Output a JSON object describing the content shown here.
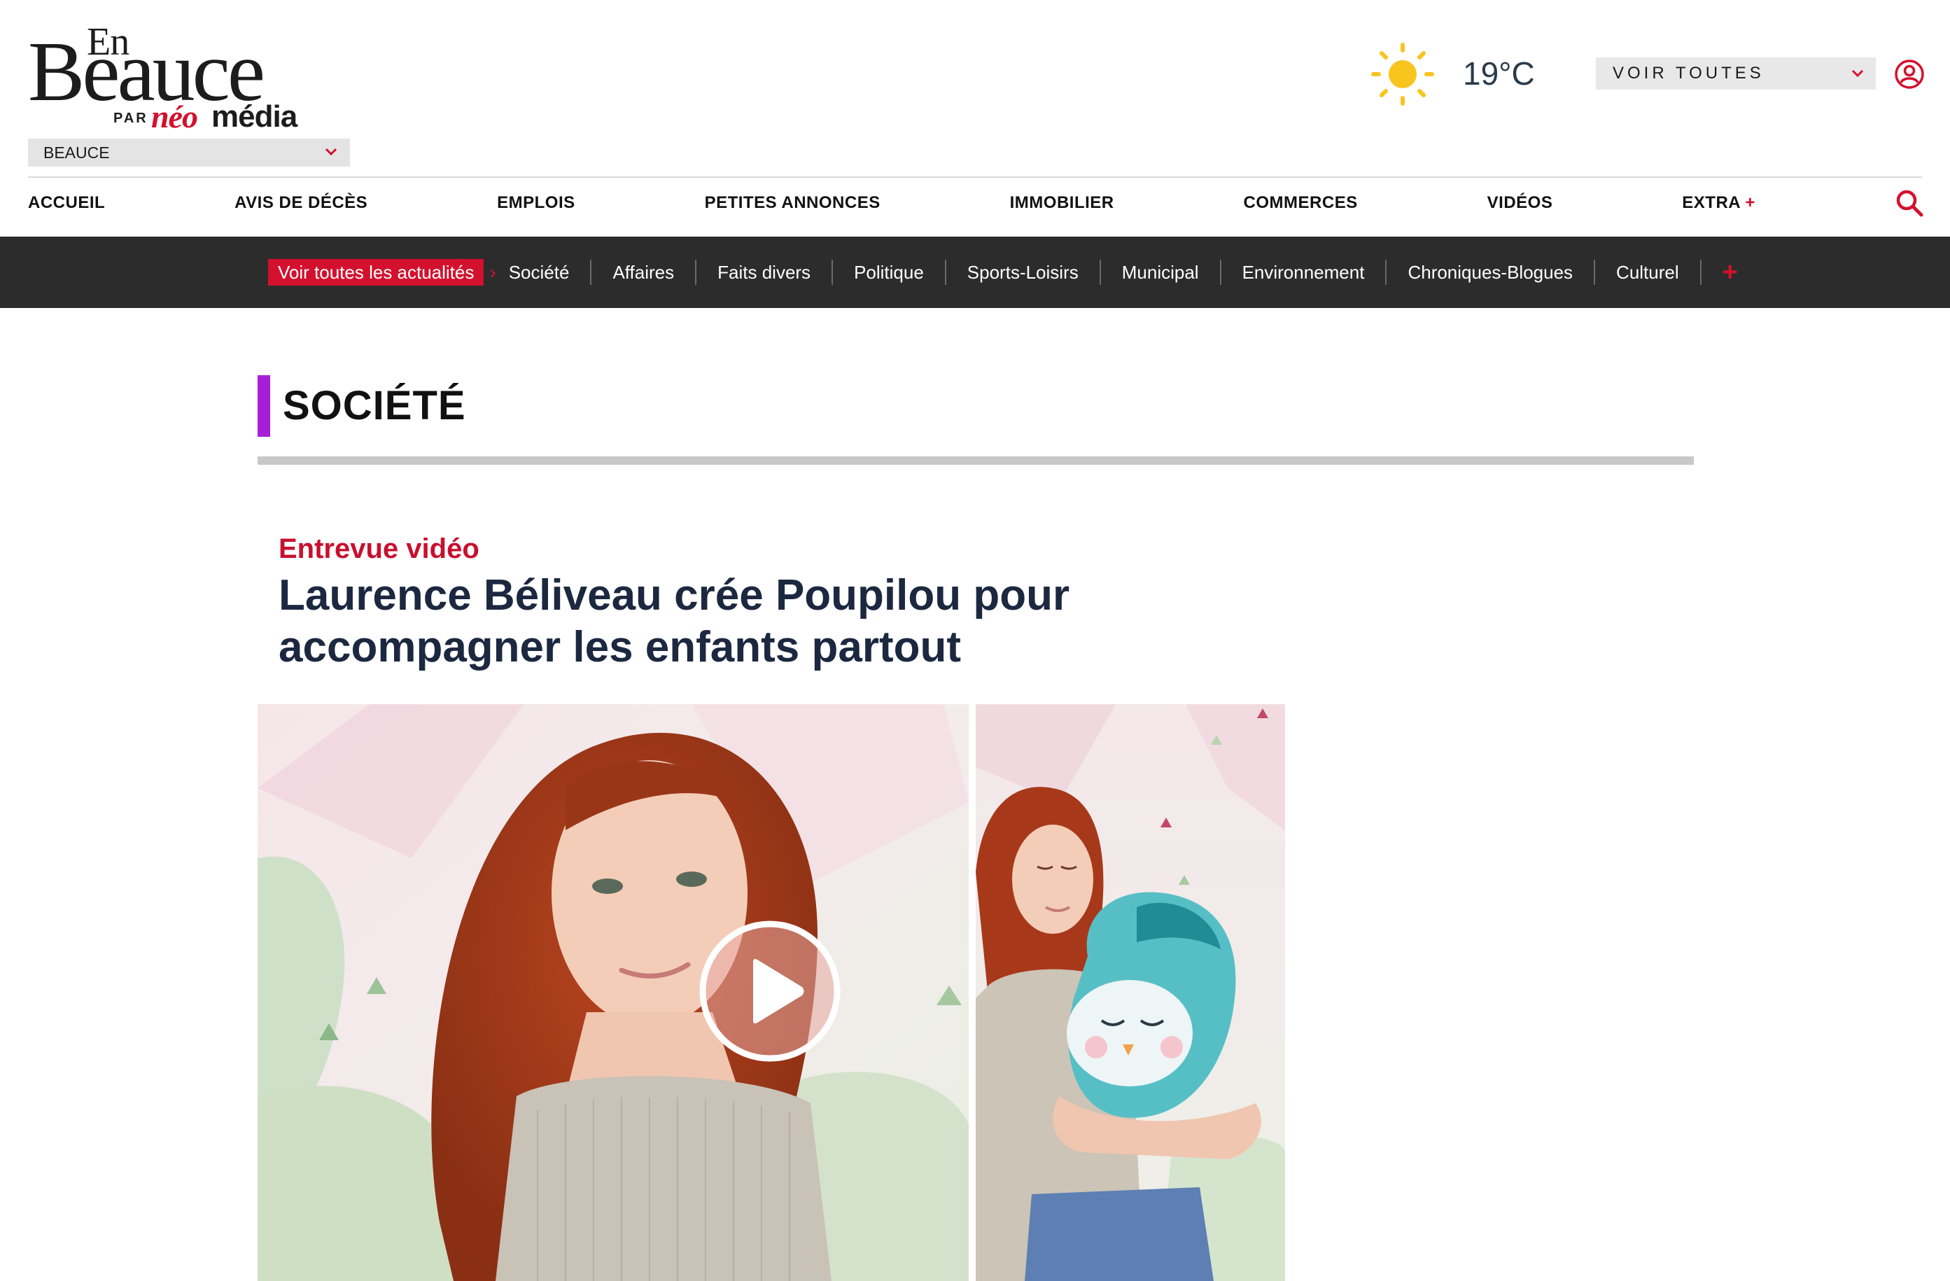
{
  "logo": {
    "en": "En",
    "beauce": "Beauce",
    "par": "PAR",
    "neo": "néo",
    "media": "média"
  },
  "region_select": {
    "value": "BEAUCE"
  },
  "weather": {
    "icon": "sun-icon",
    "temperature": "19°C"
  },
  "region_all_select": {
    "value": "VOIR TOUTES"
  },
  "main_nav": {
    "items": [
      "ACCUEIL",
      "AVIS DE DÉCÈS",
      "EMPLOIS",
      "PETITES ANNONCES",
      "IMMOBILIER",
      "COMMERCES",
      "VIDÉOS"
    ],
    "extra_label": "EXTRA",
    "extra_plus": "+"
  },
  "sub_nav": {
    "all_label": "Voir toutes les actualités",
    "arrow": "›",
    "categories": [
      "Société",
      "Affaires",
      "Faits divers",
      "Politique",
      "Sports-Loisirs",
      "Municipal",
      "Environnement",
      "Chroniques-Blogues",
      "Culturel"
    ],
    "more": "+"
  },
  "section": {
    "title": "SOCIÉTÉ"
  },
  "article": {
    "kicker": "Entrevue vidéo",
    "headline": "Laurence Béliveau crée Poupilou pour accompagner les enfants partout"
  },
  "colors": {
    "brand_red": "#d3112e",
    "section_accent": "#a81ed6",
    "subnav_bg": "#2c2c2c",
    "headline": "#1c2840"
  },
  "icons": [
    "sun-icon",
    "chevron-down-icon",
    "user-icon",
    "search-icon",
    "play-icon",
    "plus-icon"
  ]
}
